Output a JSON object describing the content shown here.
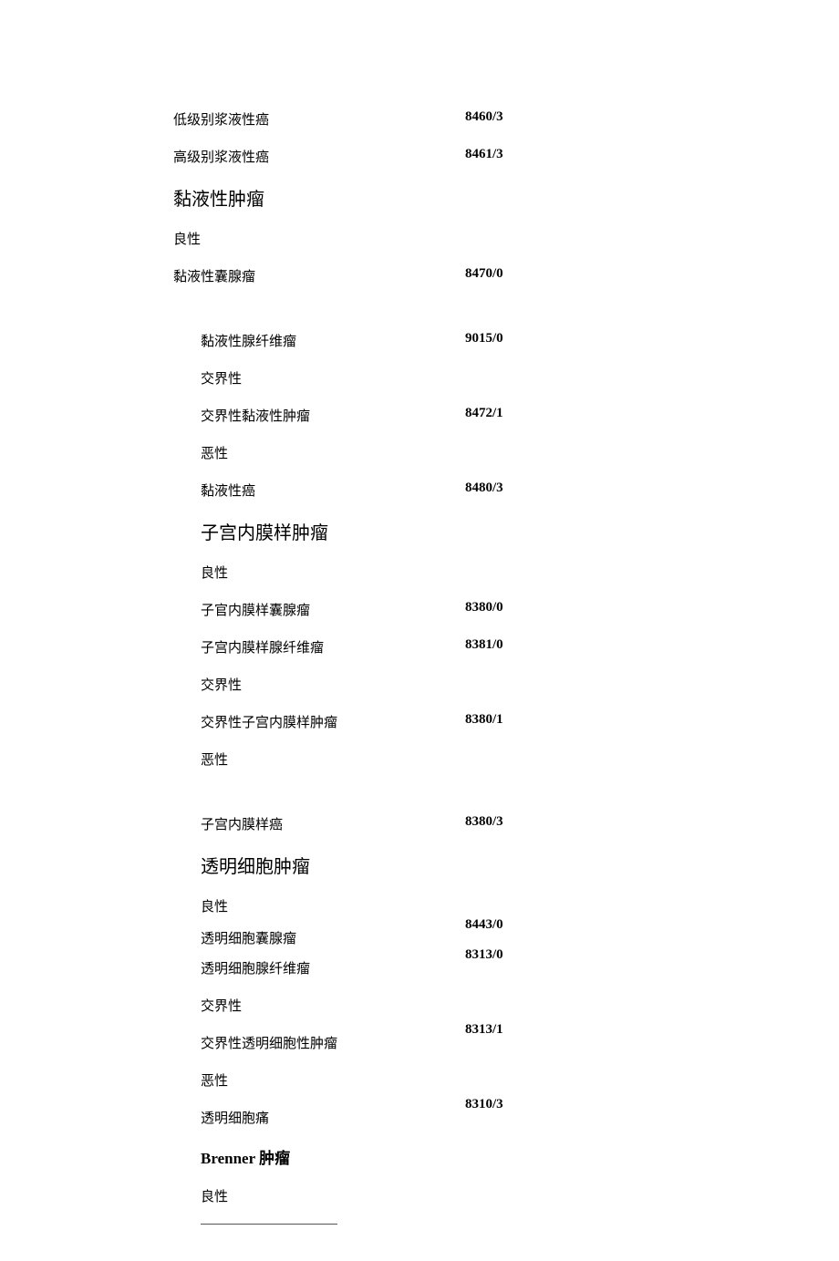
{
  "rows": {
    "low_serous": {
      "label": "低级别浆液性癌",
      "code": "8460/3"
    },
    "high_serous": {
      "label": "高级别浆液性癌",
      "code": "8461/3"
    },
    "mucinous_head": {
      "label": "黏液性肿瘤"
    },
    "benign1": {
      "label": "良性"
    },
    "muc_cyst": {
      "label": "黏液性囊腺瘤",
      "code": "8470/0"
    },
    "muc_af": {
      "label": "黏液性腺纤维瘤",
      "code": "9015/0"
    },
    "border1": {
      "label": "交界性"
    },
    "muc_border": {
      "label": "交界性黏液性肿瘤",
      "code": "8472/1"
    },
    "malig1": {
      "label": "恶性"
    },
    "muc_ca": {
      "label": "黏液性癌",
      "code": "8480/3"
    },
    "endo_head": {
      "label": "子宫内膜样肿瘤"
    },
    "benign2": {
      "label": "良性"
    },
    "endo_cyst": {
      "label": "子官内膜样囊腺瘤",
      "code": "8380/0"
    },
    "endo_af": {
      "label": "子宫内膜样腺纤维瘤",
      "code": "8381/0"
    },
    "border2": {
      "label": "交界性"
    },
    "endo_border": {
      "label": "交界性子宫内膜样肿瘤",
      "code": "8380/1"
    },
    "malig2": {
      "label": "恶性"
    },
    "endo_ca": {
      "label": "子宫内膜样癌",
      "code": "8380/3"
    },
    "clear_head": {
      "label": "透明细胞肿瘤"
    },
    "benign3": {
      "label": "良性"
    },
    "clear_cyst": {
      "label": "透明细胞囊腺瘤",
      "code": "8443/0"
    },
    "clear_af": {
      "label": "透明细胞腺纤维瘤",
      "code": "8313/0"
    },
    "border3": {
      "label": "交界性"
    },
    "clear_border": {
      "label": "交界性透明细胞性肿瘤",
      "code": "8313/1"
    },
    "malig3": {
      "label": "恶性"
    },
    "clear_ca": {
      "label": "透明细胞痛",
      "code": "8310/3"
    },
    "brenner_head": {
      "label": "Brenner 肿瘤"
    },
    "benign4": {
      "label": "良性"
    }
  }
}
